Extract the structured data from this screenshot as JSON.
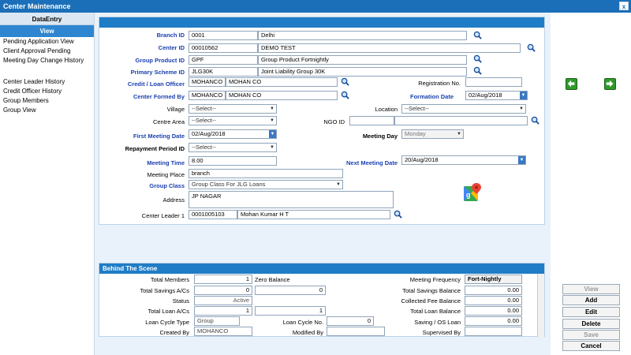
{
  "window": {
    "title": "Center Maintenance",
    "close_label": "x"
  },
  "sidebar": {
    "header": "DataEntry",
    "section": "View",
    "items_a": [
      "Pending Application View",
      "Client Approval Pending",
      "Meeting Day Change History"
    ],
    "items_b": [
      "Center Leader History",
      "Credit Officer History",
      "Group Members",
      "Group View"
    ]
  },
  "form": {
    "branch_id": {
      "label": "Branch ID",
      "code": "0001",
      "name": "Delhi"
    },
    "center_id": {
      "label": "Center ID",
      "code": "00010562",
      "name": "DEMO TEST"
    },
    "group_product_id": {
      "label": "Group Product ID",
      "code": "GPF",
      "name": "Group Product Fortnightly"
    },
    "primary_scheme_id": {
      "label": "Primary Scheme ID",
      "code": "JLG30K",
      "name": "Joint Liability Group 30K"
    },
    "credit_loan_officer": {
      "label": "Credit / Loan Officer",
      "code": "MOHANCO",
      "name": "MOHAN CO"
    },
    "registration_no": {
      "label": "Registration No.",
      "value": ""
    },
    "center_formed_by": {
      "label": "Center Formed By",
      "code": "MOHANCO",
      "name": "MOHAN CO"
    },
    "formation_date": {
      "label": "Formation Date",
      "value": "02/Aug/2018"
    },
    "village": {
      "label": "Village",
      "value": "--Select--"
    },
    "location": {
      "label": "Location",
      "value": "--Select--"
    },
    "centre_area": {
      "label": "Centre Area",
      "value": "--Select--"
    },
    "ngo_id": {
      "label": "NGO ID",
      "code": "",
      "name": ""
    },
    "first_meeting_date": {
      "label": "First Meeting Date",
      "value": "02/Aug/2018"
    },
    "meeting_day": {
      "label": "Meeting Day",
      "value": "Monday"
    },
    "repayment_period_id": {
      "label": "Repayment Period ID",
      "value": "--Select--"
    },
    "meeting_time": {
      "label": "Meeting Time",
      "value": "8.00"
    },
    "next_meeting_date": {
      "label": "Next Meeting Date",
      "value": "20/Aug/2018"
    },
    "meeting_place": {
      "label": "Meeting Place",
      "value": "branch"
    },
    "group_class": {
      "label": "Group Class",
      "value": "Group Class For JLG Loans"
    },
    "address": {
      "label": "Address",
      "value": "JP NAGAR"
    },
    "center_leader_1": {
      "label": "Center Leader 1",
      "code": "0001005103",
      "name": "Mohan Kumar H T"
    }
  },
  "behind": {
    "title": "Behind The Scene",
    "total_members": {
      "label": "Total Members",
      "value": "1"
    },
    "zero_balance": {
      "label": "Zero Balance"
    },
    "meeting_frequency": {
      "label": "Meeting Frequency",
      "value": "Fort-Nightly"
    },
    "total_savings_acs": {
      "label": "Total Savings A/Cs",
      "value": "0",
      "value2": "0"
    },
    "total_savings_balance": {
      "label": "Total Savings Balance",
      "value": "0.00"
    },
    "status": {
      "label": "Status",
      "value": "Active"
    },
    "collected_fee_balance": {
      "label": "Collected Fee Balance",
      "value": "0.00"
    },
    "total_loan_acs": {
      "label": "Total Loan A/Cs",
      "value": "1",
      "value2": "1"
    },
    "total_loan_balance": {
      "label": "Total Loan Balance",
      "value": "0.00"
    },
    "loan_cycle_type": {
      "label": "Loan Cycle Type",
      "value": "Group"
    },
    "loan_cycle_no": {
      "label": "Loan Cycle No.",
      "value": "0"
    },
    "saving_os_loan": {
      "label": "Saving / OS Loan",
      "value": "0.00"
    },
    "created_by": {
      "label": "Created By",
      "value": "MOHANCO"
    },
    "modified_by": {
      "label": "Modified By",
      "value": ""
    },
    "supervised_by": {
      "label": "Supervised By",
      "value": ""
    }
  },
  "buttons": {
    "view": "View",
    "add": "Add",
    "edit": "Edit",
    "delete": "Delete",
    "save": "Save",
    "cancel": "Cancel"
  },
  "colors": {
    "title_bar": "#1b6fb8",
    "accent": "#2e86d0",
    "label_blue": "#1a3fb0",
    "arrow_green": "#2f9a2a"
  }
}
